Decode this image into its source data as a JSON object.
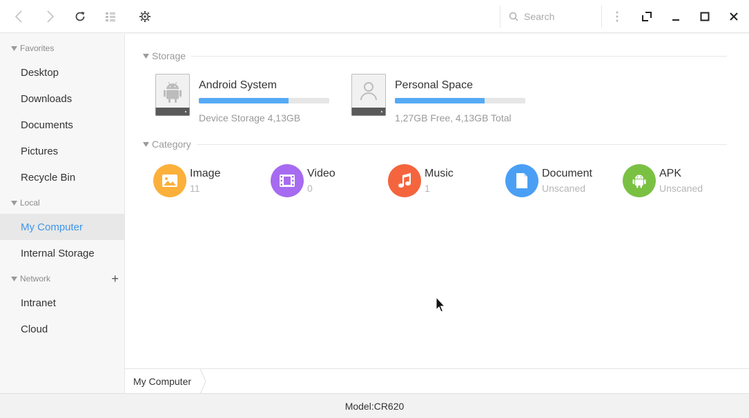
{
  "toolbar": {
    "search_placeholder": "Search",
    "icons": [
      "back-icon",
      "forward-icon",
      "refresh-icon",
      "view-mode-icon",
      "settings-icon",
      "search-icon",
      "more-icon",
      "fullscreen-icon",
      "minimize-icon",
      "maximize-icon",
      "close-icon"
    ]
  },
  "sidebar": {
    "sections": [
      {
        "label": "Favorites",
        "items": [
          "Desktop",
          "Downloads",
          "Documents",
          "Pictures",
          "Recycle Bin"
        ]
      },
      {
        "label": "Local",
        "items": [
          "My Computer",
          "Internal Storage"
        ]
      },
      {
        "label": "Network",
        "items": [
          "Intranet",
          "Cloud"
        ]
      }
    ],
    "active_item": "My Computer"
  },
  "storage": {
    "label": "Storage",
    "drives": [
      {
        "name": "Android System",
        "info": "Device Storage 4,13GB",
        "usage": 0.69,
        "icon": "android-drive-icon"
      },
      {
        "name": "Personal Space",
        "info": "1,27GB Free, 4,13GB Total",
        "usage": 0.69,
        "icon": "user-drive-icon"
      }
    ]
  },
  "category": {
    "label": "Category",
    "items": [
      {
        "name": "Image",
        "count": "11",
        "color": "#fbb03b",
        "icon": "image-icon"
      },
      {
        "name": "Video",
        "count": "0",
        "color": "#a66bf0",
        "icon": "video-icon"
      },
      {
        "name": "Music",
        "count": "1",
        "color": "#f4653e",
        "icon": "music-icon"
      },
      {
        "name": "Document",
        "count": "Unscaned",
        "color": "#4a9ff5",
        "icon": "document-icon"
      },
      {
        "name": "APK",
        "count": "Unscaned",
        "color": "#7ac143",
        "icon": "android-icon"
      }
    ]
  },
  "breadcrumb": {
    "current": "My Computer"
  },
  "status": {
    "model": "Model:CR620"
  },
  "colors": {
    "accent": "#3d95ea",
    "progress": "#56aaf5"
  }
}
